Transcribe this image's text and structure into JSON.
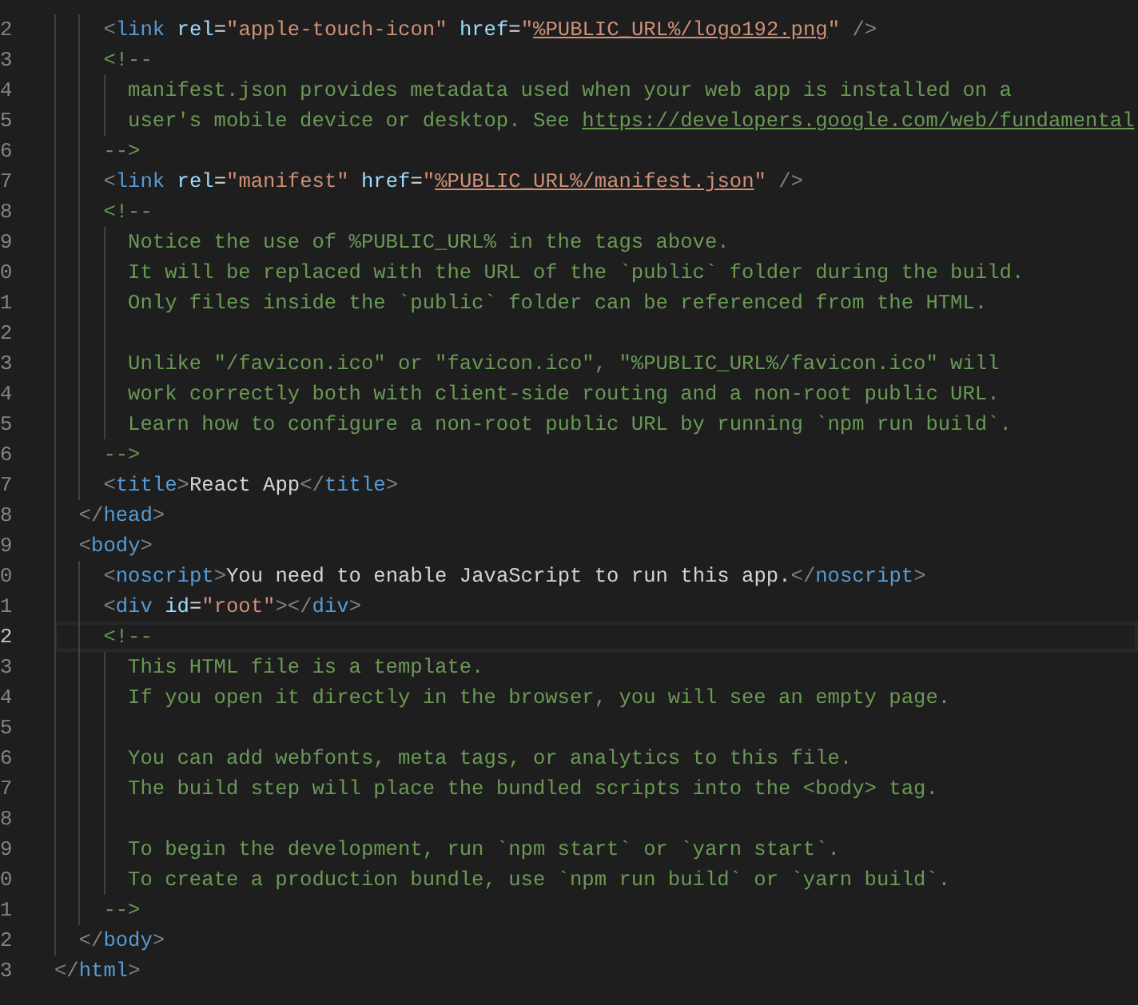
{
  "editor": {
    "lines": [
      {
        "number": "2",
        "current": false,
        "tokens": [
          {
            "kind": "punct",
            "text": "    <"
          },
          {
            "kind": "tag",
            "text": "link "
          },
          {
            "kind": "attr",
            "text": "rel"
          },
          {
            "kind": "plain",
            "text": "="
          },
          {
            "kind": "string",
            "text": "\"apple-touch-icon\" "
          },
          {
            "kind": "attr",
            "text": "href"
          },
          {
            "kind": "plain",
            "text": "="
          },
          {
            "kind": "string",
            "text": "\""
          },
          {
            "kind": "string-link",
            "text": "%PUBLIC_URL%/logo192.png"
          },
          {
            "kind": "string",
            "text": "\" "
          },
          {
            "kind": "punct",
            "text": "/>"
          }
        ]
      },
      {
        "number": "3",
        "current": false,
        "tokens": [
          {
            "kind": "comment",
            "text": "    <!--"
          }
        ]
      },
      {
        "number": "4",
        "current": false,
        "tokens": [
          {
            "kind": "comment",
            "text": "      manifest.json provides metadata used when your web app is installed on a"
          }
        ]
      },
      {
        "number": "5",
        "current": false,
        "tokens": [
          {
            "kind": "comment",
            "text": "      user's mobile device or desktop. See "
          },
          {
            "kind": "comment-link",
            "text": "https://developers.google.com/web/fundamental"
          }
        ]
      },
      {
        "number": "6",
        "current": false,
        "tokens": [
          {
            "kind": "comment",
            "text": "    -->"
          }
        ]
      },
      {
        "number": "7",
        "current": false,
        "tokens": [
          {
            "kind": "punct",
            "text": "    <"
          },
          {
            "kind": "tag",
            "text": "link "
          },
          {
            "kind": "attr",
            "text": "rel"
          },
          {
            "kind": "plain",
            "text": "="
          },
          {
            "kind": "string",
            "text": "\"manifest\" "
          },
          {
            "kind": "attr",
            "text": "href"
          },
          {
            "kind": "plain",
            "text": "="
          },
          {
            "kind": "string",
            "text": "\""
          },
          {
            "kind": "string-link",
            "text": "%PUBLIC_URL%/manifest.json"
          },
          {
            "kind": "string",
            "text": "\" "
          },
          {
            "kind": "punct",
            "text": "/>"
          }
        ]
      },
      {
        "number": "8",
        "current": false,
        "tokens": [
          {
            "kind": "comment",
            "text": "    <!--"
          }
        ]
      },
      {
        "number": "9",
        "current": false,
        "tokens": [
          {
            "kind": "comment",
            "text": "      Notice the use of %PUBLIC_URL% in the tags above."
          }
        ]
      },
      {
        "number": "0",
        "current": false,
        "tokens": [
          {
            "kind": "comment",
            "text": "      It will be replaced with the URL of the `public` folder during the build."
          }
        ]
      },
      {
        "number": "1",
        "current": false,
        "tokens": [
          {
            "kind": "comment",
            "text": "      Only files inside the `public` folder can be referenced from the HTML."
          }
        ]
      },
      {
        "number": "2",
        "current": false
      },
      {
        "number": "3",
        "current": false,
        "tokens": [
          {
            "kind": "comment",
            "text": "      Unlike \"/favicon.ico\" or \"favicon.ico\", \"%PUBLIC_URL%/favicon.ico\" will"
          }
        ]
      },
      {
        "number": "4",
        "current": false,
        "tokens": [
          {
            "kind": "comment",
            "text": "      work correctly both with client-side routing and a non-root public URL."
          }
        ]
      },
      {
        "number": "5",
        "current": false,
        "tokens": [
          {
            "kind": "comment",
            "text": "      Learn how to configure a non-root public URL by running `npm run build`."
          }
        ]
      },
      {
        "number": "6",
        "current": false,
        "tokens": [
          {
            "kind": "comment",
            "text": "    -->"
          }
        ]
      },
      {
        "number": "7",
        "current": false,
        "tokens": [
          {
            "kind": "punct",
            "text": "    <"
          },
          {
            "kind": "tag",
            "text": "title"
          },
          {
            "kind": "punct",
            "text": ">"
          },
          {
            "kind": "plain",
            "text": "React App"
          },
          {
            "kind": "punct",
            "text": "</"
          },
          {
            "kind": "tag",
            "text": "title"
          },
          {
            "kind": "punct",
            "text": ">"
          }
        ]
      },
      {
        "number": "8",
        "current": false,
        "tokens": [
          {
            "kind": "punct",
            "text": "  </"
          },
          {
            "kind": "tag",
            "text": "head"
          },
          {
            "kind": "punct",
            "text": ">"
          }
        ]
      },
      {
        "number": "9",
        "current": false,
        "tokens": [
          {
            "kind": "punct",
            "text": "  <"
          },
          {
            "kind": "tag",
            "text": "body"
          },
          {
            "kind": "punct",
            "text": ">"
          }
        ]
      },
      {
        "number": "0",
        "current": false,
        "tokens": [
          {
            "kind": "punct",
            "text": "    <"
          },
          {
            "kind": "tag",
            "text": "noscript"
          },
          {
            "kind": "punct",
            "text": ">"
          },
          {
            "kind": "plain",
            "text": "You need to enable JavaScript to run this app."
          },
          {
            "kind": "punct",
            "text": "</"
          },
          {
            "kind": "tag",
            "text": "noscript"
          },
          {
            "kind": "punct",
            "text": ">"
          }
        ]
      },
      {
        "number": "1",
        "current": false,
        "tokens": [
          {
            "kind": "punct",
            "text": "    <"
          },
          {
            "kind": "tag",
            "text": "div "
          },
          {
            "kind": "attr",
            "text": "id"
          },
          {
            "kind": "plain",
            "text": "="
          },
          {
            "kind": "string",
            "text": "\"root\""
          },
          {
            "kind": "punct",
            "text": "></"
          },
          {
            "kind": "tag",
            "text": "div"
          },
          {
            "kind": "punct",
            "text": ">"
          }
        ]
      },
      {
        "number": "2",
        "current": true,
        "tokens": [
          {
            "kind": "comment",
            "text": "    <!--"
          }
        ]
      },
      {
        "number": "3",
        "current": false,
        "tokens": [
          {
            "kind": "comment",
            "text": "      This HTML file is a template."
          }
        ]
      },
      {
        "number": "4",
        "current": false,
        "tokens": [
          {
            "kind": "comment",
            "text": "      If you open it directly in the browser, you will see an empty page."
          }
        ]
      },
      {
        "number": "5",
        "current": false
      },
      {
        "number": "6",
        "current": false,
        "tokens": [
          {
            "kind": "comment",
            "text": "      You can add webfonts, meta tags, or analytics to this file."
          }
        ]
      },
      {
        "number": "7",
        "current": false,
        "tokens": [
          {
            "kind": "comment",
            "text": "      The build step will place the bundled scripts into the <body> tag."
          }
        ]
      },
      {
        "number": "8",
        "current": false
      },
      {
        "number": "9",
        "current": false,
        "tokens": [
          {
            "kind": "comment",
            "text": "      To begin the development, run `npm start` or `yarn start`."
          }
        ]
      },
      {
        "number": "0",
        "current": false,
        "tokens": [
          {
            "kind": "comment",
            "text": "      To create a production bundle, use `npm run build` or `yarn build`."
          }
        ]
      },
      {
        "number": "1",
        "current": false,
        "tokens": [
          {
            "kind": "comment",
            "text": "    -->"
          }
        ]
      },
      {
        "number": "2",
        "current": false,
        "tokens": [
          {
            "kind": "punct",
            "text": "  </"
          },
          {
            "kind": "tag",
            "text": "body"
          },
          {
            "kind": "punct",
            "text": ">"
          }
        ]
      },
      {
        "number": "3",
        "current": false,
        "tokens": [
          {
            "kind": "punct",
            "text": "</"
          },
          {
            "kind": "tag",
            "text": "html"
          },
          {
            "kind": "punct",
            "text": ">"
          }
        ]
      }
    ]
  }
}
